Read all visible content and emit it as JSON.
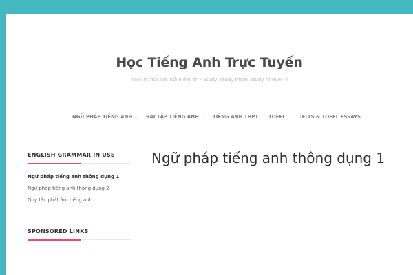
{
  "site": {
    "title": "Học Tiếng Anh Trực Tuyến",
    "tagline": "Trao tri thức kết nối niềm tin - Study, study more, study forever!!!"
  },
  "nav": {
    "items": [
      {
        "label": "NGỮ PHÁP TIẾNG ANH",
        "has_dropdown": true
      },
      {
        "label": "BÀI TẬP TIẾNG ANH",
        "has_dropdown": true
      },
      {
        "label": "TIẾNG ANH THPT",
        "has_dropdown": false
      },
      {
        "label": "TOEFL",
        "has_dropdown": false
      },
      {
        "label": "IELTS & TOEFL ESSAYS",
        "has_dropdown": false
      }
    ]
  },
  "sidebar": {
    "grammar_widget": {
      "title": "ENGLISH GRAMMAR IN USE",
      "links": [
        "Ngữ pháp tiếng anh thông dụng 1",
        "Ngữ pháp tiếng anh thông dụng 2",
        "Quy tắc phát âm tiếng anh"
      ]
    },
    "sponsored_widget": {
      "title": "SPONSORED LINKS"
    }
  },
  "main": {
    "post_title": "Ngữ pháp tiếng anh thông dụng 1"
  },
  "colors": {
    "background": "#43b8c1",
    "accent": "#e9477c"
  },
  "icons": {
    "dropdown": "chevron-down-icon"
  }
}
